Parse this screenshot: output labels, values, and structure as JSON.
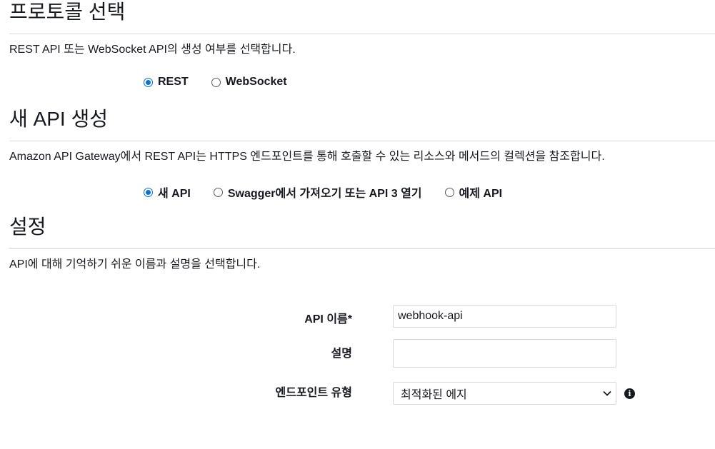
{
  "protocol": {
    "title": "프로토콜 선택",
    "description": "REST API 또는 WebSocket API의 생성 여부를 선택합니다.",
    "options": [
      {
        "label": "REST",
        "selected": true
      },
      {
        "label": "WebSocket",
        "selected": false
      }
    ]
  },
  "create_api": {
    "title": "새 API 생성",
    "description": "Amazon API Gateway에서 REST API는 HTTPS 엔드포인트를 통해 호출할 수 있는 리소스와 메서드의 컬렉션을 참조합니다.",
    "options": [
      {
        "label": "새 API",
        "selected": true
      },
      {
        "label": "Swagger에서 가져오기 또는 API 3 열기",
        "selected": false
      },
      {
        "label": "예제 API",
        "selected": false
      }
    ]
  },
  "settings": {
    "title": "설정",
    "description": "API에 대해 기억하기 쉬운 이름과 설명을 선택합니다.",
    "api_name_label": "API 이름*",
    "api_name_value": "webhook-api",
    "description_label": "설명",
    "description_value": "",
    "endpoint_type_label": "엔드포인트 유형",
    "endpoint_type_value": "최적화된 에지",
    "info_icon": "info-icon",
    "info_glyph": "i"
  },
  "colors": {
    "accent": "#0972d3",
    "divider": "#d5dbdb",
    "text": "#16191f"
  }
}
